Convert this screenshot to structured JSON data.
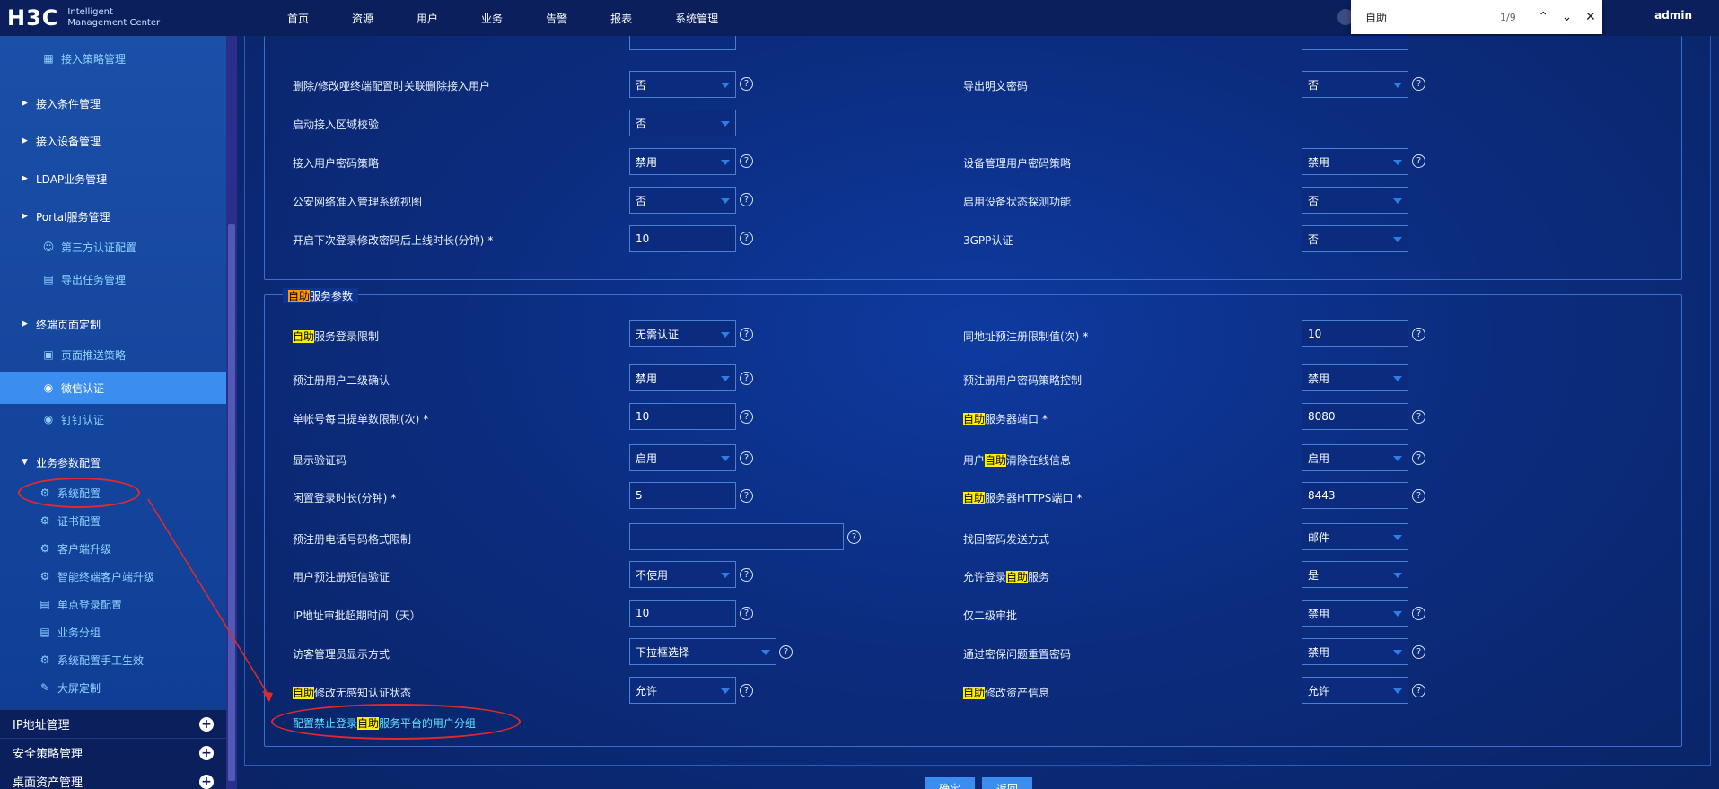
{
  "header": {
    "logo_mark": "H3C",
    "logo_line1": "Intelligent",
    "logo_line2": "Management Center",
    "nav": [
      "首页",
      "资源",
      "用户",
      "业务",
      "告警",
      "报表",
      "系统管理"
    ],
    "user": "admin"
  },
  "findbar": {
    "query": "自助",
    "count": "1/9",
    "up_icon": "chevron-up-icon",
    "down_icon": "chevron-down-icon",
    "close_icon": "close-icon"
  },
  "sidebar": {
    "items": [
      {
        "label": "接入策略管理",
        "type": "sub"
      },
      {
        "label": "接入条件管理",
        "type": "l1"
      },
      {
        "label": "接入设备管理",
        "type": "l1"
      },
      {
        "label": "LDAP业务管理",
        "type": "l1"
      },
      {
        "label": "Portal服务管理",
        "type": "l1"
      },
      {
        "label": "第三方认证配置",
        "type": "sub"
      },
      {
        "label": "导出任务管理",
        "type": "sub"
      },
      {
        "label": "终端页面定制",
        "type": "l1"
      },
      {
        "label": "页面推送策略",
        "type": "sub"
      },
      {
        "label": "微信认证",
        "type": "sub"
      },
      {
        "label": "钉钉认证",
        "type": "sub"
      },
      {
        "label": "业务参数配置",
        "type": "l1"
      },
      {
        "label": "系统配置",
        "type": "l2"
      },
      {
        "label": "证书配置",
        "type": "l2"
      },
      {
        "label": "客户端升级",
        "type": "l2"
      },
      {
        "label": "智能终端客户端升级",
        "type": "l2"
      },
      {
        "label": "单点登录配置",
        "type": "l2"
      },
      {
        "label": "业务分组",
        "type": "l2"
      },
      {
        "label": "系统配置手工生效",
        "type": "l2"
      },
      {
        "label": "大屏定制",
        "type": "l2"
      }
    ],
    "groups": [
      "IP地址管理",
      "安全策略管理",
      "桌面资产管理"
    ]
  },
  "panel1": {
    "rows": [
      {
        "left_label": "删除/修改哑终端配置时关联删除接入用户",
        "left_value": "否",
        "right_label": "导出明文密码",
        "right_value": "否"
      },
      {
        "left_label": "启动接入区域校验",
        "left_value": "否"
      },
      {
        "left_label": "接入用户密码策略",
        "left_value": "禁用",
        "right_label": "设备管理用户密码策略",
        "right_value": "禁用"
      },
      {
        "left_label": "公安网络准入管理系统视图",
        "left_value": "否",
        "right_label": "启用设备状态探测功能",
        "right_value": "否"
      },
      {
        "left_label": "开启下次登录修改密码后上线时长(分钟)",
        "left_value": "10",
        "right_label": "3GPP认证",
        "right_value": "否"
      }
    ]
  },
  "panel2": {
    "title_hl": "自助",
    "title_rest": "服务参数",
    "rows": [
      {
        "l_hl": "自助",
        "l_rest": "服务登录限制",
        "l_value": "无需认证",
        "r_hl": "",
        "r_rest": "同地址预注册限制值(次)",
        "r_value": "10"
      },
      {
        "l_hl": "",
        "l_rest": "预注册用户二级确认",
        "l_value": "禁用",
        "r_hl": "",
        "r_rest": "预注册用户密码策略控制",
        "r_value": "禁用"
      },
      {
        "l_hl": "",
        "l_rest": "单帐号每日提单数限制(次)",
        "l_value": "10",
        "r_hl": "自助",
        "r_rest": "服务器端口",
        "r_value": "8080"
      },
      {
        "l_hl": "",
        "l_rest": "显示验证码",
        "l_value": "启用",
        "r_pre": "用户",
        "r_hl": "自助",
        "r_rest": "清除在线信息",
        "r_value": "启用"
      },
      {
        "l_hl": "",
        "l_rest": "闲置登录时长(分钟)",
        "l_value": "5",
        "r_hl": "自助",
        "r_rest": "服务器HTTPS端口",
        "r_value": "8443"
      },
      {
        "l_hl": "",
        "l_rest": "预注册电话号码格式限制",
        "l_value": "",
        "r_hl": "",
        "r_rest": "找回密码发送方式",
        "r_value": "邮件"
      },
      {
        "l_hl": "",
        "l_rest": "用户预注册短信验证",
        "l_value": "不使用",
        "r_pre": "允许登录",
        "r_hl": "自助",
        "r_rest": "服务",
        "r_value": "是"
      },
      {
        "l_hl": "",
        "l_rest": "IP地址审批超期时间（天）",
        "l_value": "10",
        "r_hl": "",
        "r_rest": "仅二级审批",
        "r_value": "禁用"
      },
      {
        "l_hl": "",
        "l_rest": "访客管理员显示方式",
        "l_value": "下拉框选择",
        "r_hl": "",
        "r_rest": "通过密保问题重置密码",
        "r_value": "禁用"
      },
      {
        "l_hl": "自助",
        "l_rest": "修改无感知认证状态",
        "l_value": "允许",
        "r_hl": "自助",
        "r_rest": "修改资产信息",
        "r_value": "允许"
      }
    ],
    "link_pre": "配置禁止登录",
    "link_hl": "自助",
    "link_rest": "服务平台的用户分组"
  },
  "buttons": {
    "ok": "确定",
    "back": "返回"
  },
  "colors": {
    "accent": "#3b8ef0",
    "highlight": "#ffef00",
    "annotation": "#e32a2a"
  }
}
